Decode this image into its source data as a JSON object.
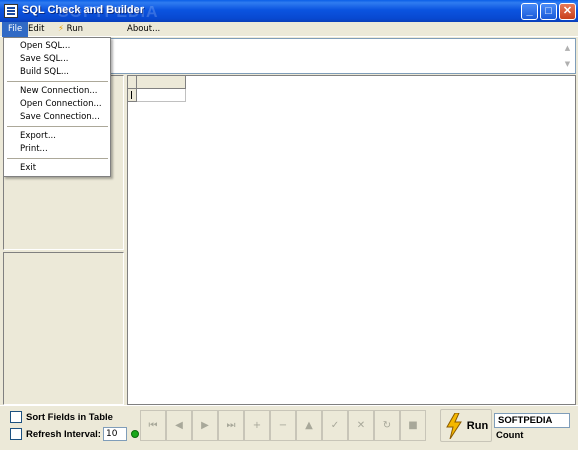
{
  "window": {
    "title": "SQL Check and Builder",
    "watermark": "SOFTPEDIA",
    "minimize_label": "_",
    "maximize_label": "□",
    "close_label": "✕"
  },
  "menubar": {
    "file": "File",
    "edit": "Edit",
    "run": "Run",
    "about": "About..."
  },
  "file_menu": {
    "open_sql": "Open SQL...",
    "save_sql": "Save SQL...",
    "build_sql": "Build SQL...",
    "new_connection": "New Connection...",
    "open_connection": "Open Connection...",
    "save_connection": "Save Connection...",
    "export": "Export...",
    "print": "Print...",
    "exit": "Exit"
  },
  "sql_scroll": {
    "up": "▲",
    "down": "▼"
  },
  "options": {
    "sort_fields_label": "Sort Fields in Table",
    "sort_fields_checked": false,
    "refresh_interval_label": "Refresh Interval:",
    "refresh_interval_checked": false,
    "refresh_interval_value": "10",
    "status_color": "#1aa81a"
  },
  "navigator": {
    "buttons": [
      {
        "name": "first-record-button",
        "glyph": "⏮"
      },
      {
        "name": "prior-record-button",
        "glyph": "◀"
      },
      {
        "name": "next-record-button",
        "glyph": "▶"
      },
      {
        "name": "last-record-button",
        "glyph": "⏭"
      },
      {
        "name": "insert-record-button",
        "glyph": "+"
      },
      {
        "name": "delete-record-button",
        "glyph": "−"
      },
      {
        "name": "edit-record-button",
        "glyph": "▲"
      },
      {
        "name": "post-record-button",
        "glyph": "✓"
      },
      {
        "name": "cancel-record-button",
        "glyph": "✕"
      },
      {
        "name": "refresh-button",
        "glyph": "↻"
      },
      {
        "name": "stop-button",
        "glyph": "■"
      }
    ]
  },
  "run_button": {
    "label": "Run",
    "icon": "lightning-bolt-icon"
  },
  "count": {
    "value": "SOFTPEDIA",
    "label": "Count"
  }
}
